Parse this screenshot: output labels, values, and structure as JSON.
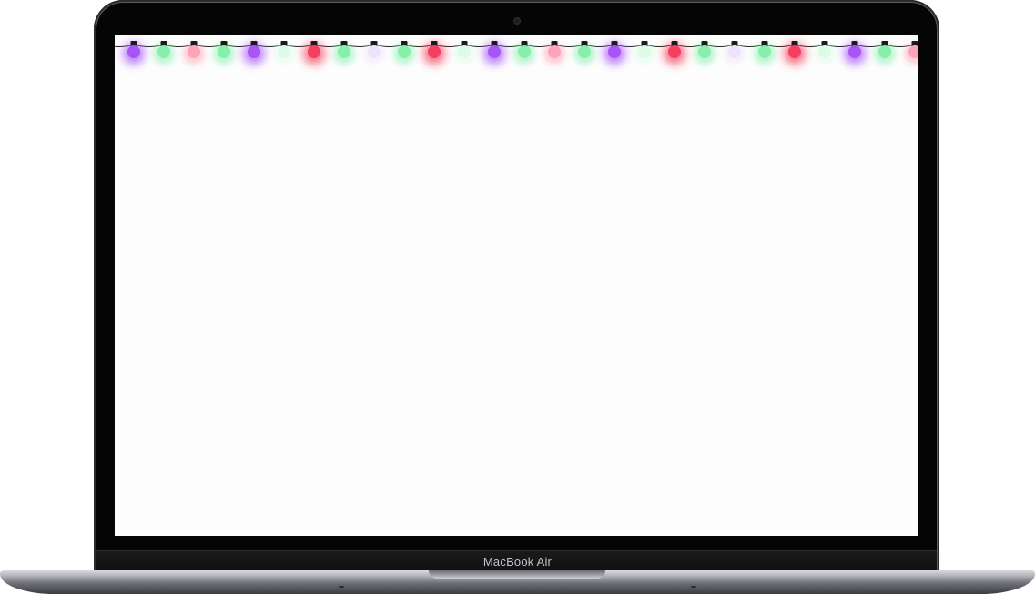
{
  "device": {
    "model_label": "MacBook Air"
  },
  "screen": {
    "decoration": "string-lights",
    "background": "#fdfdfd",
    "wire_color": "#222222",
    "socket_color": "#1b1b1b",
    "bulbs": [
      {
        "color": "purple",
        "hex": "#a855f7",
        "glow": "strong"
      },
      {
        "color": "green",
        "hex": "#86efac",
        "glow": "medium"
      },
      {
        "color": "pink",
        "hex": "#fda4b8",
        "glow": "medium"
      },
      {
        "color": "green",
        "hex": "#86efac",
        "glow": "medium"
      },
      {
        "color": "purple",
        "hex": "#a855f7",
        "glow": "strong"
      },
      {
        "color": "green",
        "hex": "#dcfce7",
        "glow": "faint"
      },
      {
        "color": "red",
        "hex": "#f43f5e",
        "glow": "strong"
      },
      {
        "color": "green",
        "hex": "#86efac",
        "glow": "medium"
      },
      {
        "color": "purple",
        "hex": "#ede4fb",
        "glow": "faint"
      },
      {
        "color": "green",
        "hex": "#86efac",
        "glow": "medium"
      },
      {
        "color": "red",
        "hex": "#f43f5e",
        "glow": "strong"
      },
      {
        "color": "green",
        "hex": "#dcfce7",
        "glow": "faint"
      },
      {
        "color": "purple",
        "hex": "#a855f7",
        "glow": "strong"
      },
      {
        "color": "green",
        "hex": "#86efac",
        "glow": "medium"
      },
      {
        "color": "pink",
        "hex": "#fda4b8",
        "glow": "medium"
      },
      {
        "color": "green",
        "hex": "#86efac",
        "glow": "medium"
      },
      {
        "color": "purple",
        "hex": "#a855f7",
        "glow": "strong"
      },
      {
        "color": "green",
        "hex": "#dcfce7",
        "glow": "faint"
      },
      {
        "color": "red",
        "hex": "#f43f5e",
        "glow": "strong"
      },
      {
        "color": "green",
        "hex": "#86efac",
        "glow": "medium"
      },
      {
        "color": "purple",
        "hex": "#ede4fb",
        "glow": "faint"
      },
      {
        "color": "green",
        "hex": "#86efac",
        "glow": "medium"
      },
      {
        "color": "red",
        "hex": "#f43f5e",
        "glow": "strong"
      },
      {
        "color": "green",
        "hex": "#dcfce7",
        "glow": "faint"
      },
      {
        "color": "purple",
        "hex": "#a855f7",
        "glow": "strong"
      },
      {
        "color": "green",
        "hex": "#86efac",
        "glow": "medium"
      },
      {
        "color": "pink",
        "hex": "#fda4b8",
        "glow": "medium"
      }
    ]
  }
}
